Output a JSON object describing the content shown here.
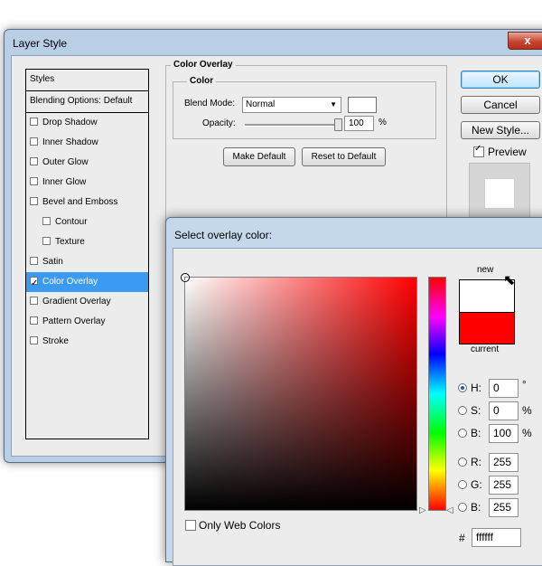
{
  "layer_style": {
    "title": "Layer Style",
    "close_symbol": "x",
    "styles_header": "Styles",
    "blending_options": "Blending Options: Default",
    "items": [
      {
        "label": "Drop Shadow",
        "checked": false
      },
      {
        "label": "Inner Shadow",
        "checked": false
      },
      {
        "label": "Outer Glow",
        "checked": false
      },
      {
        "label": "Inner Glow",
        "checked": false
      },
      {
        "label": "Bevel and Emboss",
        "checked": false
      },
      {
        "label": "Contour",
        "checked": false
      },
      {
        "label": "Texture",
        "checked": false
      },
      {
        "label": "Satin",
        "checked": false
      },
      {
        "label": "Color Overlay",
        "checked": true
      },
      {
        "label": "Gradient Overlay",
        "checked": false
      },
      {
        "label": "Pattern Overlay",
        "checked": false
      },
      {
        "label": "Stroke",
        "checked": false
      }
    ],
    "group_title": "Color Overlay",
    "color_section": "Color",
    "blend_mode_label": "Blend Mode:",
    "blend_mode_value": "Normal",
    "opacity_label": "Opacity:",
    "opacity_value": "100",
    "opacity_unit": "%",
    "opacity_level": 1.0,
    "make_default": "Make Default",
    "reset_default": "Reset to Default",
    "ok": "OK",
    "cancel": "Cancel",
    "new_style": "New Style...",
    "preview_label": "Preview",
    "preview_checked": true,
    "overlay_color": "#ffffff"
  },
  "color_picker": {
    "title": "Select overlay color:",
    "new_label": "new",
    "current_label": "current",
    "new_color": "#ffffff",
    "current_color": "#ff0000",
    "hue_base_color": "#ff0000",
    "fields": {
      "h": {
        "label": "H:",
        "value": "0",
        "unit": "°"
      },
      "s": {
        "label": "S:",
        "value": "0",
        "unit": "%"
      },
      "b": {
        "label": "B:",
        "value": "100",
        "unit": "%"
      },
      "r": {
        "label": "R:",
        "value": "255"
      },
      "g": {
        "label": "G:",
        "value": "255"
      },
      "b2": {
        "label": "B:",
        "value": "255"
      }
    },
    "hex_label": "#",
    "hex_value": "ffffff",
    "only_web_colors": "Only Web Colors"
  }
}
